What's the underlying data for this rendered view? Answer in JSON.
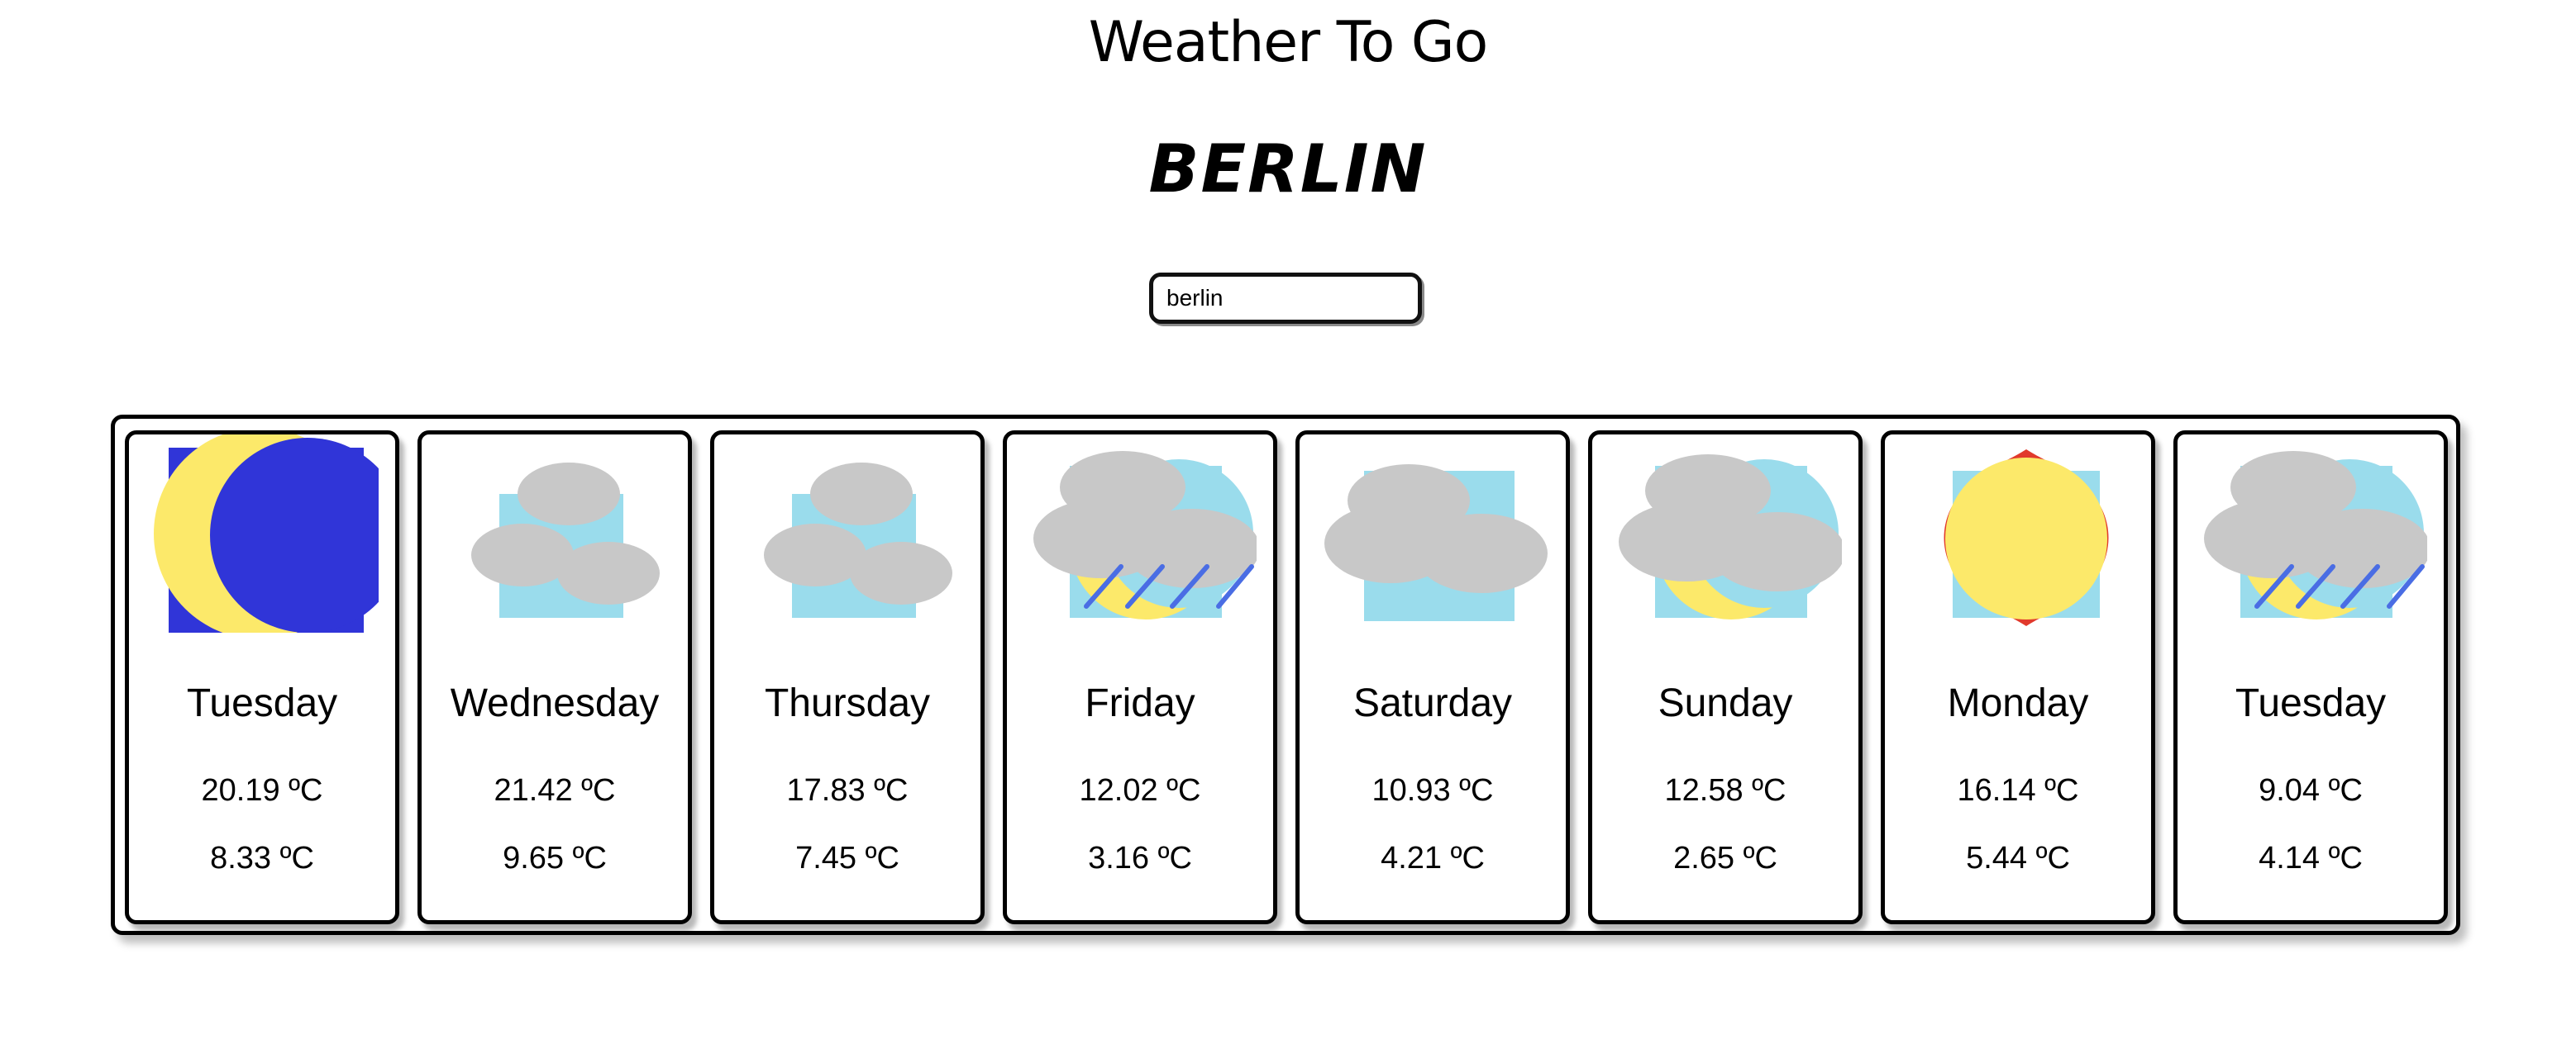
{
  "app": {
    "title": "Weather To Go"
  },
  "location": {
    "city": "BERLIN"
  },
  "search": {
    "value": "berlin"
  },
  "forecast": [
    {
      "day": "Tuesday",
      "high": "20.19 ºC",
      "low": "8.33 ºC",
      "icon": "clear-night-icon"
    },
    {
      "day": "Wednesday",
      "high": "21.42 ºC",
      "low": "9.65 ºC",
      "icon": "scattered-clouds-icon"
    },
    {
      "day": "Thursday",
      "high": "17.83 ºC",
      "low": "7.45 ºC",
      "icon": "scattered-clouds-icon"
    },
    {
      "day": "Friday",
      "high": "12.02 ºC",
      "low": "3.16 ºC",
      "icon": "rain-icon"
    },
    {
      "day": "Saturday",
      "high": "10.93 ºC",
      "low": "4.21 ºC",
      "icon": "overcast-clouds-icon"
    },
    {
      "day": "Sunday",
      "high": "12.58 ºC",
      "low": "2.65 ºC",
      "icon": "partly-cloudy-icon"
    },
    {
      "day": "Monday",
      "high": "16.14 ºC",
      "low": "5.44 ºC",
      "icon": "sunny-icon"
    },
    {
      "day": "Tuesday",
      "high": "9.04 ºC",
      "low": "4.14 ºC",
      "icon": "rain-icon"
    }
  ],
  "colors": {
    "sky": "#9adcec",
    "night_sky": "#3035d8",
    "sun": "#fce96a",
    "sun_halo": "#e13a2c",
    "cloud": "#c8c8c8",
    "rain": "#4a6de4"
  }
}
